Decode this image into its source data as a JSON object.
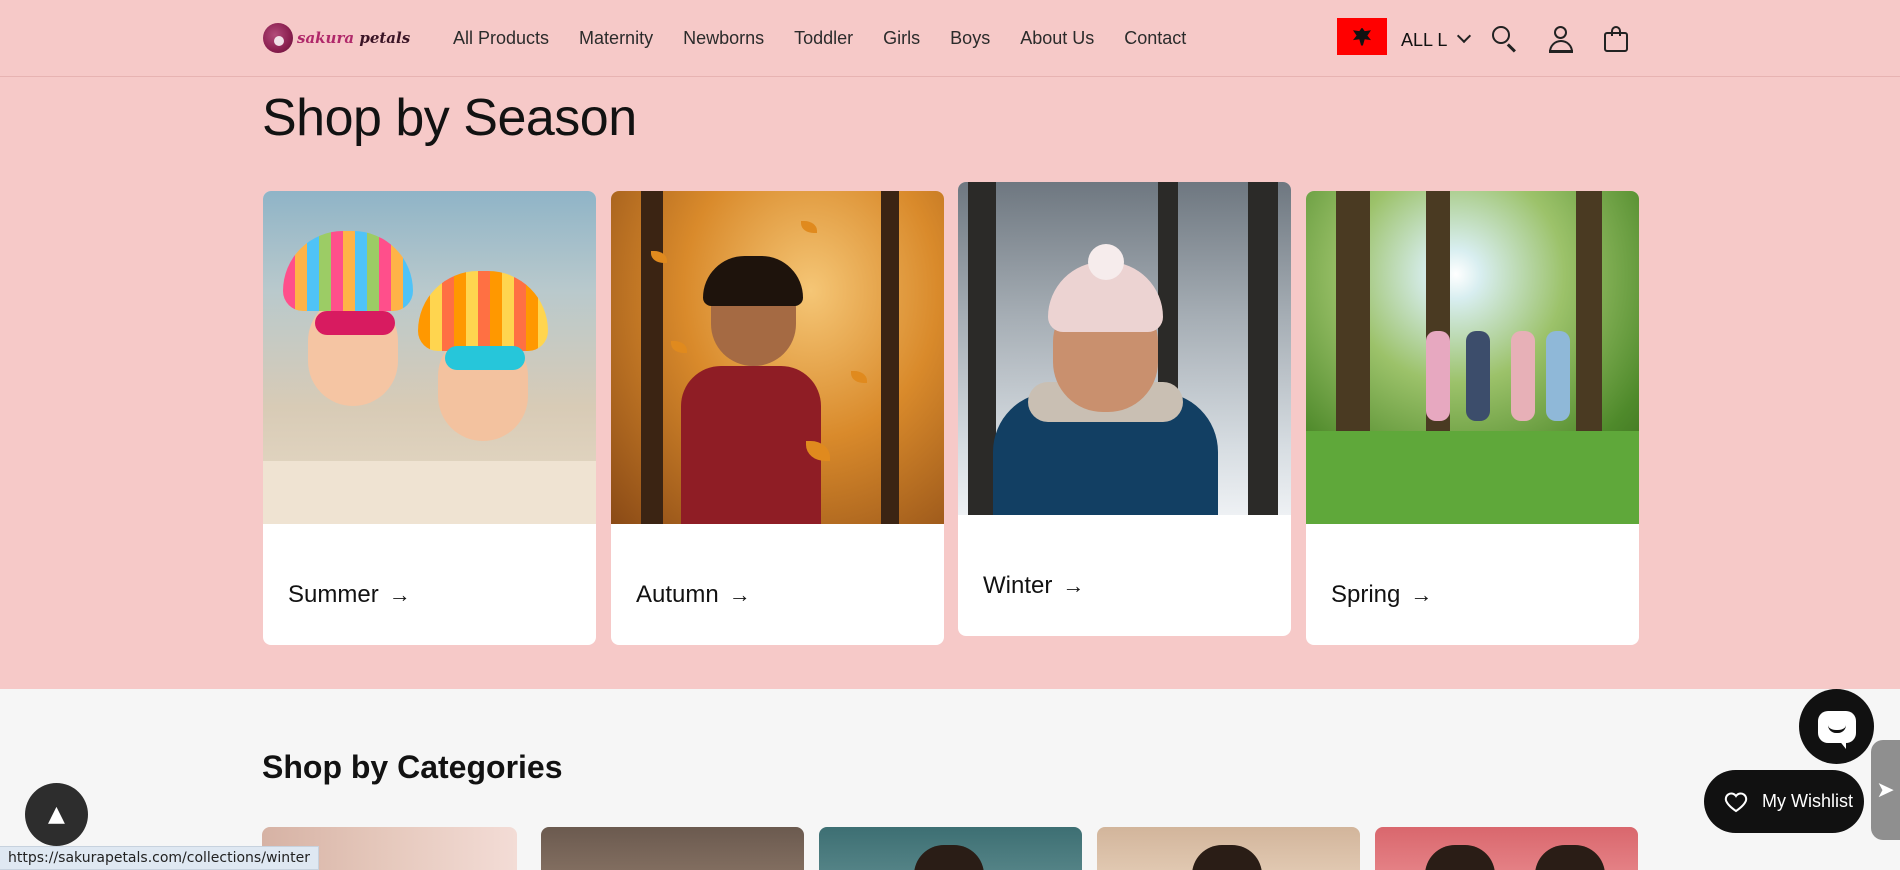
{
  "header": {
    "logo_text_accent": "sakura",
    "logo_text_rest": "petals",
    "nav": [
      {
        "label": "All Products"
      },
      {
        "label": "Maternity"
      },
      {
        "label": "Newborns"
      },
      {
        "label": "Toddler"
      },
      {
        "label": "Girls"
      },
      {
        "label": "Boys"
      },
      {
        "label": "About Us"
      },
      {
        "label": "Contact"
      }
    ],
    "currency": "ALL L",
    "flag_color": "#ff0000",
    "icons": [
      "search-icon",
      "account-icon",
      "cart-icon"
    ]
  },
  "season": {
    "title": "Shop by Season",
    "cards": [
      {
        "label": "Summer",
        "arrow": "→"
      },
      {
        "label": "Autumn",
        "arrow": "→"
      },
      {
        "label": "Winter",
        "arrow": "→"
      },
      {
        "label": "Spring",
        "arrow": "→"
      }
    ]
  },
  "categories": {
    "title": "Shop by Categories"
  },
  "floating": {
    "scroll_top_glyph": "▲",
    "wishlist_label": "My Wishlist",
    "side_tab_glyph": "➤",
    "status_url": "https://sakurapetals.com/collections/winter"
  },
  "colors": {
    "background_pink": "#f6c9c8",
    "categories_bg": "#f6f6f6",
    "dark_button": "#111111"
  }
}
